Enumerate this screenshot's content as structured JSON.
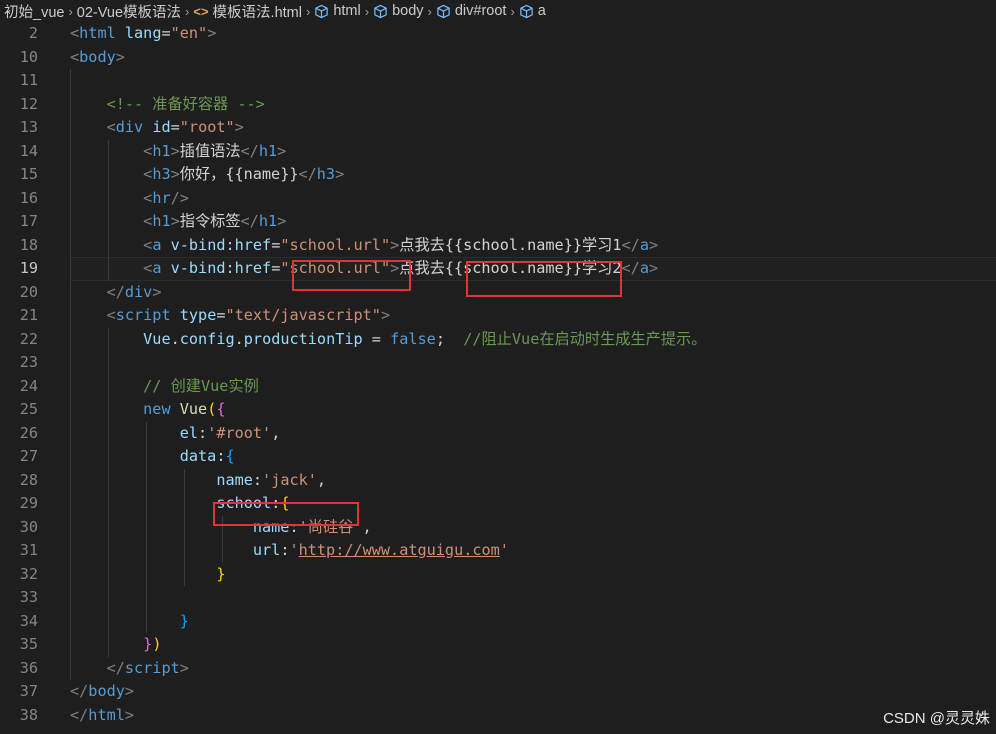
{
  "breadcrumb": [
    {
      "label": "初始_vue",
      "icon": ""
    },
    {
      "label": "02-Vue模板语法",
      "icon": ""
    },
    {
      "label": "模板语法.html",
      "icon": "html-tag-icon"
    },
    {
      "label": "html",
      "icon": "cube-icon"
    },
    {
      "label": "body",
      "icon": "cube-icon"
    },
    {
      "label": "div#root",
      "icon": "cube-icon"
    },
    {
      "label": "a",
      "icon": "cube-icon"
    }
  ],
  "active_line": 19,
  "lines": [
    {
      "n": 2,
      "guides": [],
      "tokens": [
        [
          "t-tag",
          "<"
        ],
        [
          "t-name",
          "html"
        ],
        [
          "t-text",
          " "
        ],
        [
          "t-attr",
          "lang"
        ],
        [
          "t-text",
          "="
        ],
        [
          "t-str",
          "\"en\""
        ],
        [
          "t-tag",
          ">"
        ]
      ]
    },
    {
      "n": 10,
      "guides": [],
      "tokens": [
        [
          "t-tag",
          "<"
        ],
        [
          "t-name",
          "body"
        ],
        [
          "t-tag",
          ">"
        ]
      ]
    },
    {
      "n": 11,
      "guides": [
        1
      ],
      "tokens": []
    },
    {
      "n": 12,
      "guides": [
        1
      ],
      "tokens": [
        [
          "t-text",
          "    "
        ],
        [
          "t-com",
          "<!-- 准备好容器 -->"
        ]
      ]
    },
    {
      "n": 13,
      "guides": [
        1
      ],
      "tokens": [
        [
          "t-text",
          "    "
        ],
        [
          "t-tag",
          "<"
        ],
        [
          "t-name",
          "div"
        ],
        [
          "t-text",
          " "
        ],
        [
          "t-attr",
          "id"
        ],
        [
          "t-text",
          "="
        ],
        [
          "t-str",
          "\"root\""
        ],
        [
          "t-tag",
          ">"
        ]
      ]
    },
    {
      "n": 14,
      "guides": [
        1,
        2
      ],
      "tokens": [
        [
          "t-text",
          "        "
        ],
        [
          "t-tag",
          "<"
        ],
        [
          "t-name",
          "h1"
        ],
        [
          "t-tag",
          ">"
        ],
        [
          "t-text",
          "插值语法"
        ],
        [
          "t-tag",
          "</"
        ],
        [
          "t-name",
          "h1"
        ],
        [
          "t-tag",
          ">"
        ]
      ]
    },
    {
      "n": 15,
      "guides": [
        1,
        2
      ],
      "tokens": [
        [
          "t-text",
          "        "
        ],
        [
          "t-tag",
          "<"
        ],
        [
          "t-name",
          "h3"
        ],
        [
          "t-tag",
          ">"
        ],
        [
          "t-text",
          "你好，{{name}}"
        ],
        [
          "t-tag",
          "</"
        ],
        [
          "t-name",
          "h3"
        ],
        [
          "t-tag",
          ">"
        ]
      ]
    },
    {
      "n": 16,
      "guides": [
        1,
        2
      ],
      "tokens": [
        [
          "t-text",
          "        "
        ],
        [
          "t-tag",
          "<"
        ],
        [
          "t-name",
          "hr"
        ],
        [
          "t-tag",
          "/>"
        ]
      ]
    },
    {
      "n": 17,
      "guides": [
        1,
        2
      ],
      "tokens": [
        [
          "t-text",
          "        "
        ],
        [
          "t-tag",
          "<"
        ],
        [
          "t-name",
          "h1"
        ],
        [
          "t-tag",
          ">"
        ],
        [
          "t-text",
          "指令标签"
        ],
        [
          "t-tag",
          "</"
        ],
        [
          "t-name",
          "h1"
        ],
        [
          "t-tag",
          ">"
        ]
      ]
    },
    {
      "n": 18,
      "guides": [
        1,
        2
      ],
      "tokens": [
        [
          "t-text",
          "        "
        ],
        [
          "t-tag",
          "<"
        ],
        [
          "t-name",
          "a"
        ],
        [
          "t-text",
          " "
        ],
        [
          "t-attr",
          "v-bind:href"
        ],
        [
          "t-text",
          "="
        ],
        [
          "t-str",
          "\"school.url\""
        ],
        [
          "t-tag",
          ">"
        ],
        [
          "t-text",
          "点我去{{school.name}}学习1"
        ],
        [
          "t-tag",
          "</"
        ],
        [
          "t-name",
          "a"
        ],
        [
          "t-tag",
          ">"
        ]
      ]
    },
    {
      "n": 19,
      "guides": [
        1,
        2
      ],
      "tokens": [
        [
          "t-text",
          "        "
        ],
        [
          "t-tag",
          "<"
        ],
        [
          "t-name",
          "a"
        ],
        [
          "t-text",
          " "
        ],
        [
          "t-attr",
          "v-bind:href"
        ],
        [
          "t-text",
          "="
        ],
        [
          "t-str",
          "\"school.url\""
        ],
        [
          "t-tag",
          ">"
        ],
        [
          "t-text",
          "点我去{{school.name}}学习2"
        ],
        [
          "t-tag",
          "</"
        ],
        [
          "t-name",
          "a"
        ],
        [
          "t-tag",
          ">"
        ]
      ]
    },
    {
      "n": 20,
      "guides": [
        1
      ],
      "tokens": [
        [
          "t-text",
          "    "
        ],
        [
          "t-tag",
          "</"
        ],
        [
          "t-name",
          "div"
        ],
        [
          "t-tag",
          ">"
        ]
      ]
    },
    {
      "n": 21,
      "guides": [
        1
      ],
      "tokens": [
        [
          "t-text",
          "    "
        ],
        [
          "t-tag",
          "<"
        ],
        [
          "t-name",
          "script"
        ],
        [
          "t-text",
          " "
        ],
        [
          "t-attr",
          "type"
        ],
        [
          "t-text",
          "="
        ],
        [
          "t-str",
          "\"text/javascript\""
        ],
        [
          "t-tag",
          ">"
        ]
      ]
    },
    {
      "n": 22,
      "guides": [
        1,
        2
      ],
      "tokens": [
        [
          "t-text",
          "        "
        ],
        [
          "t-var",
          "Vue"
        ],
        [
          "t-text",
          "."
        ],
        [
          "t-var",
          "config"
        ],
        [
          "t-text",
          "."
        ],
        [
          "t-var",
          "productionTip"
        ],
        [
          "t-text",
          " = "
        ],
        [
          "t-kw",
          "false"
        ],
        [
          "t-text",
          ";  "
        ],
        [
          "t-com",
          "//阻止Vue在启动时生成生产提示。"
        ]
      ]
    },
    {
      "n": 23,
      "guides": [
        1,
        2
      ],
      "tokens": []
    },
    {
      "n": 24,
      "guides": [
        1,
        2
      ],
      "tokens": [
        [
          "t-text",
          "        "
        ],
        [
          "t-com",
          "// 创建Vue实例"
        ]
      ]
    },
    {
      "n": 25,
      "guides": [
        1,
        2
      ],
      "tokens": [
        [
          "t-text",
          "        "
        ],
        [
          "t-kw",
          "new"
        ],
        [
          "t-text",
          " "
        ],
        [
          "t-fn",
          "Vue"
        ],
        [
          "t-b1",
          "("
        ],
        [
          "t-b2",
          "{"
        ]
      ]
    },
    {
      "n": 26,
      "guides": [
        1,
        2,
        3
      ],
      "tokens": [
        [
          "t-text",
          "            "
        ],
        [
          "t-var",
          "el"
        ],
        [
          "t-text",
          ":"
        ],
        [
          "t-str",
          "'#root'"
        ],
        [
          "t-text",
          ","
        ]
      ]
    },
    {
      "n": 27,
      "guides": [
        1,
        2,
        3
      ],
      "tokens": [
        [
          "t-text",
          "            "
        ],
        [
          "t-var",
          "data"
        ],
        [
          "t-text",
          ":"
        ],
        [
          "t-b3",
          "{"
        ]
      ]
    },
    {
      "n": 28,
      "guides": [
        1,
        2,
        3,
        4
      ],
      "tokens": [
        [
          "t-text",
          "                "
        ],
        [
          "t-var",
          "name"
        ],
        [
          "t-text",
          ":"
        ],
        [
          "t-str",
          "'jack'"
        ],
        [
          "t-text",
          ","
        ]
      ]
    },
    {
      "n": 29,
      "guides": [
        1,
        2,
        3,
        4
      ],
      "tokens": [
        [
          "t-text",
          "                "
        ],
        [
          "t-var",
          "school"
        ],
        [
          "t-text",
          ":"
        ],
        [
          "t-b1",
          "{"
        ]
      ]
    },
    {
      "n": 30,
      "guides": [
        1,
        2,
        3,
        4,
        5
      ],
      "tokens": [
        [
          "t-text",
          "                    "
        ],
        [
          "t-var",
          "name"
        ],
        [
          "t-text",
          ":"
        ],
        [
          "t-str",
          "'尚硅谷'"
        ],
        [
          "t-text",
          ","
        ]
      ]
    },
    {
      "n": 31,
      "guides": [
        1,
        2,
        3,
        4,
        5
      ],
      "tokens": [
        [
          "t-text",
          "                    "
        ],
        [
          "t-var",
          "url"
        ],
        [
          "t-text",
          ":"
        ],
        [
          "t-str",
          "'"
        ],
        [
          "t-url",
          "http://www.atguigu.com"
        ],
        [
          "t-str",
          "'"
        ]
      ]
    },
    {
      "n": 32,
      "guides": [
        1,
        2,
        3,
        4
      ],
      "tokens": [
        [
          "t-text",
          "                "
        ],
        [
          "t-b1",
          "}"
        ]
      ]
    },
    {
      "n": 33,
      "guides": [
        1,
        2,
        3
      ],
      "tokens": []
    },
    {
      "n": 34,
      "guides": [
        1,
        2,
        3
      ],
      "tokens": [
        [
          "t-text",
          "            "
        ],
        [
          "t-b3",
          "}"
        ]
      ]
    },
    {
      "n": 35,
      "guides": [
        1,
        2
      ],
      "tokens": [
        [
          "t-text",
          "        "
        ],
        [
          "t-b2",
          "}"
        ],
        [
          "t-b1",
          ")"
        ]
      ]
    },
    {
      "n": 36,
      "guides": [
        1
      ],
      "tokens": [
        [
          "t-text",
          "    "
        ],
        [
          "t-tag",
          "</"
        ],
        [
          "t-name",
          "script"
        ],
        [
          "t-tag",
          ">"
        ]
      ]
    },
    {
      "n": 37,
      "guides": [],
      "tokens": [
        [
          "t-tag",
          "</"
        ],
        [
          "t-name",
          "body"
        ],
        [
          "t-tag",
          ">"
        ]
      ]
    },
    {
      "n": 38,
      "guides": [],
      "tokens": [
        [
          "t-tag",
          "</"
        ],
        [
          "t-name",
          "html"
        ],
        [
          "t-tag",
          ">"
        ]
      ]
    }
  ],
  "watermark": "CSDN @灵灵姝",
  "highlight_color": "#e03535"
}
